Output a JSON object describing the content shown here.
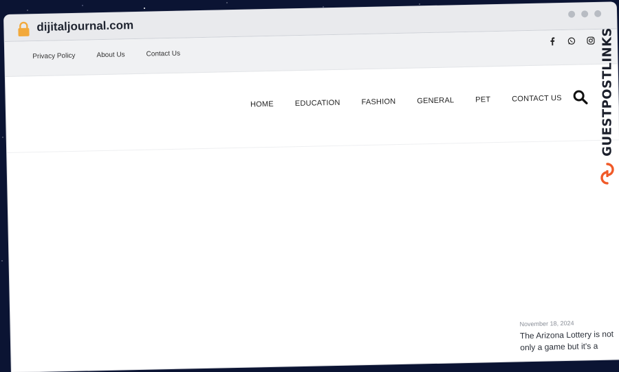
{
  "browser": {
    "url": "dijitaljournal.com"
  },
  "topbar": {
    "links": [
      "Privacy Policy",
      "About Us",
      "Contact Us"
    ],
    "social": [
      "facebook-icon",
      "whatsapp-icon",
      "instagram-icon"
    ]
  },
  "nav": {
    "items": [
      "HOME",
      "EDUCATION",
      "FASHION",
      "GENERAL",
      "PET",
      "CONTACT US"
    ]
  },
  "post": {
    "date": "November 18, 2024",
    "excerpt": "The Arizona Lottery is not only a game but it's a"
  },
  "watermark": {
    "text": "GUESTPOSTLINKS"
  },
  "colors": {
    "background": "#0b1433",
    "accent": "#f05a28",
    "lock": "#f2a93b"
  }
}
